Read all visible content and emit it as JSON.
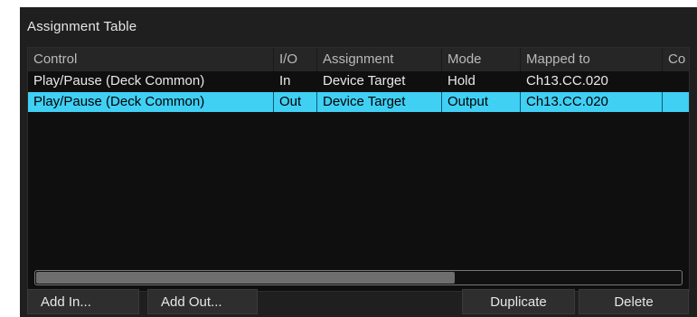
{
  "panel": {
    "title": "Assignment Table"
  },
  "table": {
    "columns": [
      "Control",
      "I/O",
      "Assignment",
      "Mode",
      "Mapped to",
      "Co"
    ],
    "rows": [
      {
        "control": "Play/Pause (Deck Common)",
        "io": "In",
        "assignment": "Device Target",
        "mode": "Hold",
        "mapped_to": "Ch13.CC.020",
        "comment": "",
        "selected": false
      },
      {
        "control": "Play/Pause (Deck Common)",
        "io": "Out",
        "assignment": "Device Target",
        "mode": "Output",
        "mapped_to": "Ch13.CC.020",
        "comment": "",
        "selected": true
      }
    ],
    "horizontal_scroll_fraction": 0.65
  },
  "buttons": {
    "add_in": "Add In...",
    "add_out": "Add Out...",
    "duplicate": "Duplicate",
    "delete": "Delete"
  },
  "colors": {
    "selection": "#3fd0f4",
    "panel_background": "#1f1f1f",
    "table_background": "#0f0f0f"
  }
}
